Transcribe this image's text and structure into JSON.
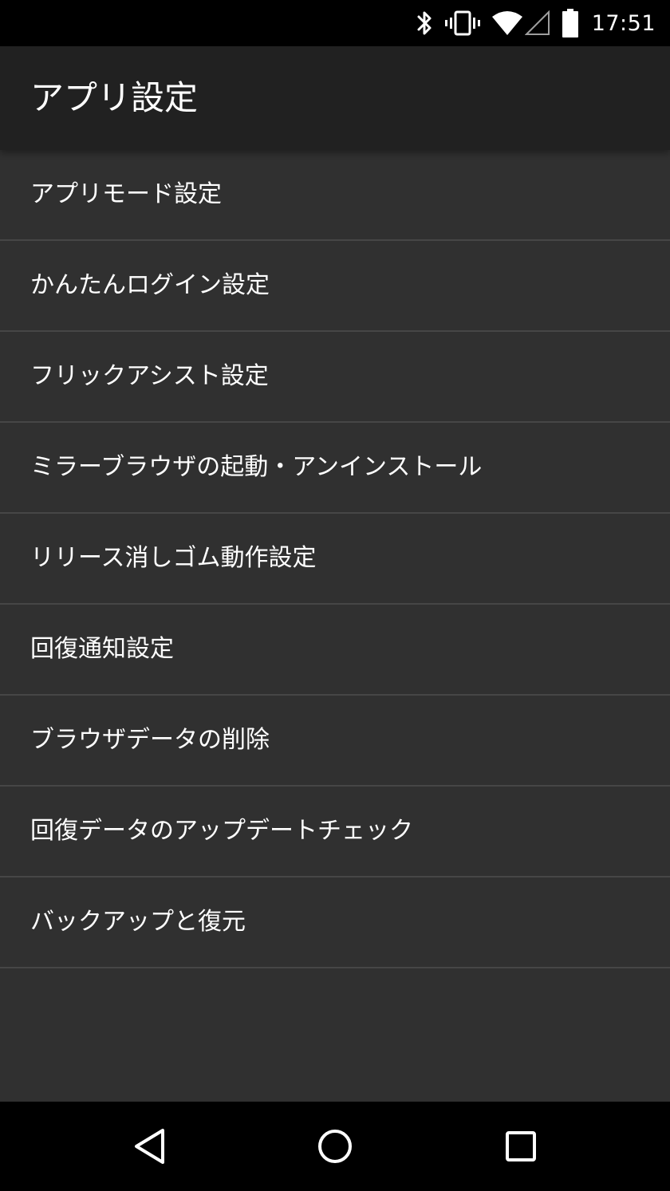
{
  "status_bar": {
    "time": "17:51",
    "icons": [
      "bluetooth-icon",
      "vibrate-icon",
      "wifi-icon",
      "signal-icon",
      "battery-icon"
    ]
  },
  "app_bar": {
    "title": "アプリ設定"
  },
  "settings": {
    "items": [
      {
        "label": "アプリモード設定"
      },
      {
        "label": "かんたんログイン設定"
      },
      {
        "label": "フリックアシスト設定"
      },
      {
        "label": "ミラーブラウザの起動・アンインストール"
      },
      {
        "label": "リリース消しゴム動作設定"
      },
      {
        "label": "回復通知設定"
      },
      {
        "label": "ブラウザデータの削除"
      },
      {
        "label": "回復データのアップデートチェック"
      },
      {
        "label": "バックアップと復元"
      }
    ]
  },
  "nav_bar": {
    "icons": [
      "back-icon",
      "home-icon",
      "recents-icon"
    ]
  },
  "colors": {
    "background": "#303030",
    "app_bar": "#212121",
    "divider": "#464646",
    "text": "#ffffff"
  }
}
